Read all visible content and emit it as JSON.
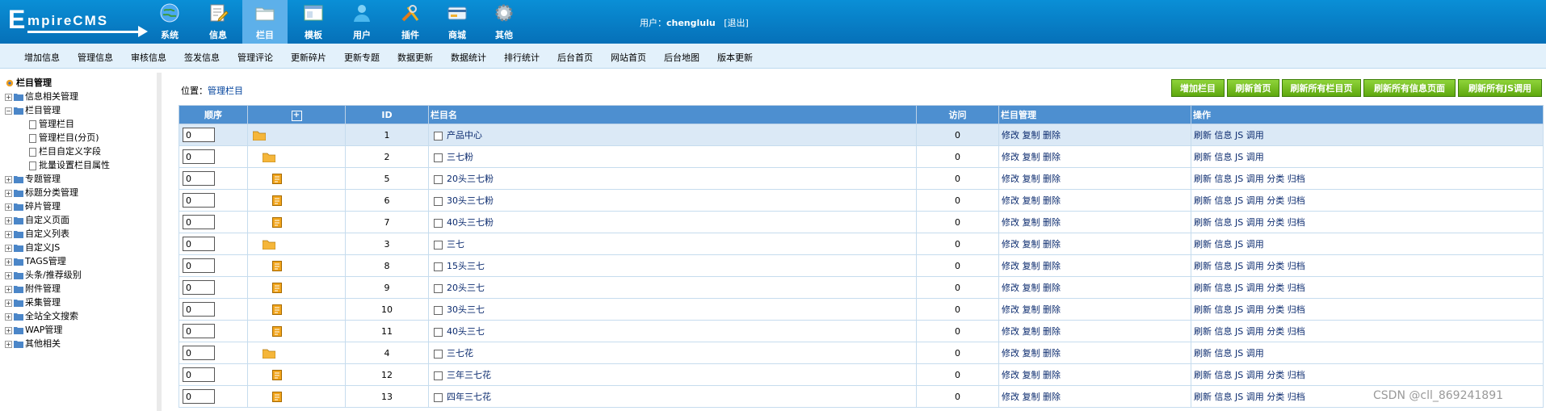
{
  "header": {
    "logo_text": "EmpireCMS",
    "nav": [
      {
        "label": "系统",
        "icon": "globe-icon",
        "active": false
      },
      {
        "label": "信息",
        "icon": "edit-document-icon",
        "active": false
      },
      {
        "label": "栏目",
        "icon": "folder-icon",
        "active": true
      },
      {
        "label": "模板",
        "icon": "template-window-icon",
        "active": false
      },
      {
        "label": "用户",
        "icon": "user-icon",
        "active": false
      },
      {
        "label": "插件",
        "icon": "tools-icon",
        "active": false
      },
      {
        "label": "商城",
        "icon": "shop-card-icon",
        "active": false
      },
      {
        "label": "其他",
        "icon": "gear-icon",
        "active": false
      }
    ],
    "user_prefix": "用户：",
    "username": "chenglulu",
    "logout": "[退出]"
  },
  "subnav": [
    "增加信息",
    "管理信息",
    "审核信息",
    "签发信息",
    "管理评论",
    "更新碎片",
    "更新专题",
    "数据更新",
    "数据统计",
    "排行统计",
    "后台首页",
    "网站首页",
    "后台地图",
    "版本更新"
  ],
  "sidebar": {
    "title": "栏目管理",
    "items": [
      {
        "label": "信息相关管理",
        "level": 0,
        "type": "collapsed"
      },
      {
        "label": "栏目管理",
        "level": 0,
        "type": "expanded"
      },
      {
        "label": "管理栏目",
        "level": 1,
        "type": "doc"
      },
      {
        "label": "管理栏目(分页)",
        "level": 1,
        "type": "doc"
      },
      {
        "label": "栏目自定义字段",
        "level": 1,
        "type": "doc"
      },
      {
        "label": "批量设置栏目属性",
        "level": 1,
        "type": "doc"
      },
      {
        "label": "专题管理",
        "level": 0,
        "type": "collapsed"
      },
      {
        "label": "标题分类管理",
        "level": 0,
        "type": "collapsed"
      },
      {
        "label": "碎片管理",
        "level": 0,
        "type": "collapsed"
      },
      {
        "label": "自定义页面",
        "level": 0,
        "type": "collapsed"
      },
      {
        "label": "自定义列表",
        "level": 0,
        "type": "collapsed"
      },
      {
        "label": "自定义JS",
        "level": 0,
        "type": "collapsed"
      },
      {
        "label": "TAGS管理",
        "level": 0,
        "type": "collapsed"
      },
      {
        "label": "头条/推荐级别",
        "level": 0,
        "type": "collapsed"
      },
      {
        "label": "附件管理",
        "level": 0,
        "type": "collapsed"
      },
      {
        "label": "采集管理",
        "level": 0,
        "type": "collapsed"
      },
      {
        "label": "全站全文搜索",
        "level": 0,
        "type": "collapsed"
      },
      {
        "label": "WAP管理",
        "level": 0,
        "type": "collapsed"
      },
      {
        "label": "其他相关",
        "level": 0,
        "type": "collapsed"
      }
    ]
  },
  "location": {
    "prefix": "位置：",
    "link": "管理栏目"
  },
  "buttons": [
    "增加栏目",
    "刷新首页",
    "刷新所有栏目页",
    "刷新所有信息页面",
    "刷新所有JS调用"
  ],
  "table": {
    "headers": {
      "order": "顺序",
      "expand": "+",
      "id": "ID",
      "name": "栏目名",
      "visits": "访问",
      "manage": "栏目管理",
      "ops": "操作"
    },
    "rows": [
      {
        "order": "0",
        "id": "1",
        "name": "产品中心",
        "visits": "0",
        "kind": "folder",
        "level": 0,
        "ops": "刷新 信息 JS 调用"
      },
      {
        "order": "0",
        "id": "2",
        "name": "三七粉",
        "visits": "0",
        "kind": "folder",
        "level": 1,
        "ops": "刷新 信息 JS 调用"
      },
      {
        "order": "0",
        "id": "5",
        "name": "20头三七粉",
        "visits": "0",
        "kind": "file",
        "level": 2,
        "ops": "刷新 信息 JS 调用 分类 归档"
      },
      {
        "order": "0",
        "id": "6",
        "name": "30头三七粉",
        "visits": "0",
        "kind": "file",
        "level": 2,
        "ops": "刷新 信息 JS 调用 分类 归档"
      },
      {
        "order": "0",
        "id": "7",
        "name": "40头三七粉",
        "visits": "0",
        "kind": "file",
        "level": 2,
        "ops": "刷新 信息 JS 调用 分类 归档"
      },
      {
        "order": "0",
        "id": "3",
        "name": "三七",
        "visits": "0",
        "kind": "folder",
        "level": 1,
        "ops": "刷新 信息 JS 调用"
      },
      {
        "order": "0",
        "id": "8",
        "name": "15头三七",
        "visits": "0",
        "kind": "file",
        "level": 2,
        "ops": "刷新 信息 JS 调用 分类 归档"
      },
      {
        "order": "0",
        "id": "9",
        "name": "20头三七",
        "visits": "0",
        "kind": "file",
        "level": 2,
        "ops": "刷新 信息 JS 调用 分类 归档"
      },
      {
        "order": "0",
        "id": "10",
        "name": "30头三七",
        "visits": "0",
        "kind": "file",
        "level": 2,
        "ops": "刷新 信息 JS 调用 分类 归档"
      },
      {
        "order": "0",
        "id": "11",
        "name": "40头三七",
        "visits": "0",
        "kind": "file",
        "level": 2,
        "ops": "刷新 信息 JS 调用 分类 归档"
      },
      {
        "order": "0",
        "id": "4",
        "name": "三七花",
        "visits": "0",
        "kind": "folder",
        "level": 1,
        "ops": "刷新 信息 JS 调用"
      },
      {
        "order": "0",
        "id": "12",
        "name": "三年三七花",
        "visits": "0",
        "kind": "file",
        "level": 2,
        "ops": "刷新 信息 JS 调用 分类 归档"
      },
      {
        "order": "0",
        "id": "13",
        "name": "四年三七花",
        "visits": "0",
        "kind": "file",
        "level": 2,
        "ops": "刷新 信息 JS 调用 分类 归档"
      }
    ],
    "manage_links": "修改 复制 删除"
  },
  "watermark": "CSDN @cll_869241891",
  "colors": {
    "header": "#0670b8",
    "subnav": "#e3f1fb",
    "table_header": "#4d8fd0",
    "button": "#5ea80e"
  }
}
